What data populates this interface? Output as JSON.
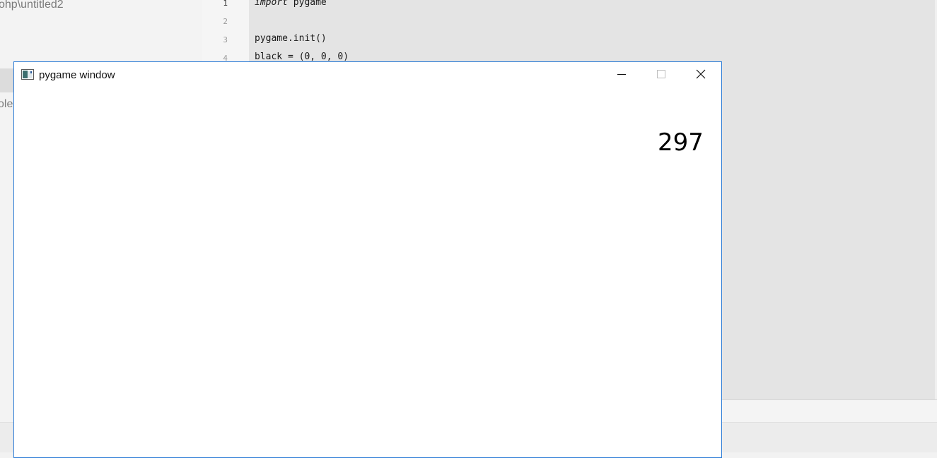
{
  "ide": {
    "project_path": "ohp\\untitled2",
    "console_label": "ole",
    "line_numbers": [
      "1",
      "2",
      "3",
      "4"
    ],
    "code_lines": [
      {
        "keyword": "import",
        "rest": " pygame"
      },
      {
        "keyword": "",
        "rest": ""
      },
      {
        "keyword": "",
        "rest": "pygame.init()"
      },
      {
        "keyword": "",
        "rest": "black = (0, 0, 0)"
      }
    ]
  },
  "pygame_window": {
    "title": "pygame window",
    "score": "297",
    "icons": {
      "app": "pygame-app-icon",
      "minimize": "minimize-icon",
      "maximize": "maximize-icon",
      "close": "close-icon"
    },
    "colors": {
      "border": "#2b7bd6",
      "background": "#ffffff",
      "text": "#000000"
    }
  }
}
